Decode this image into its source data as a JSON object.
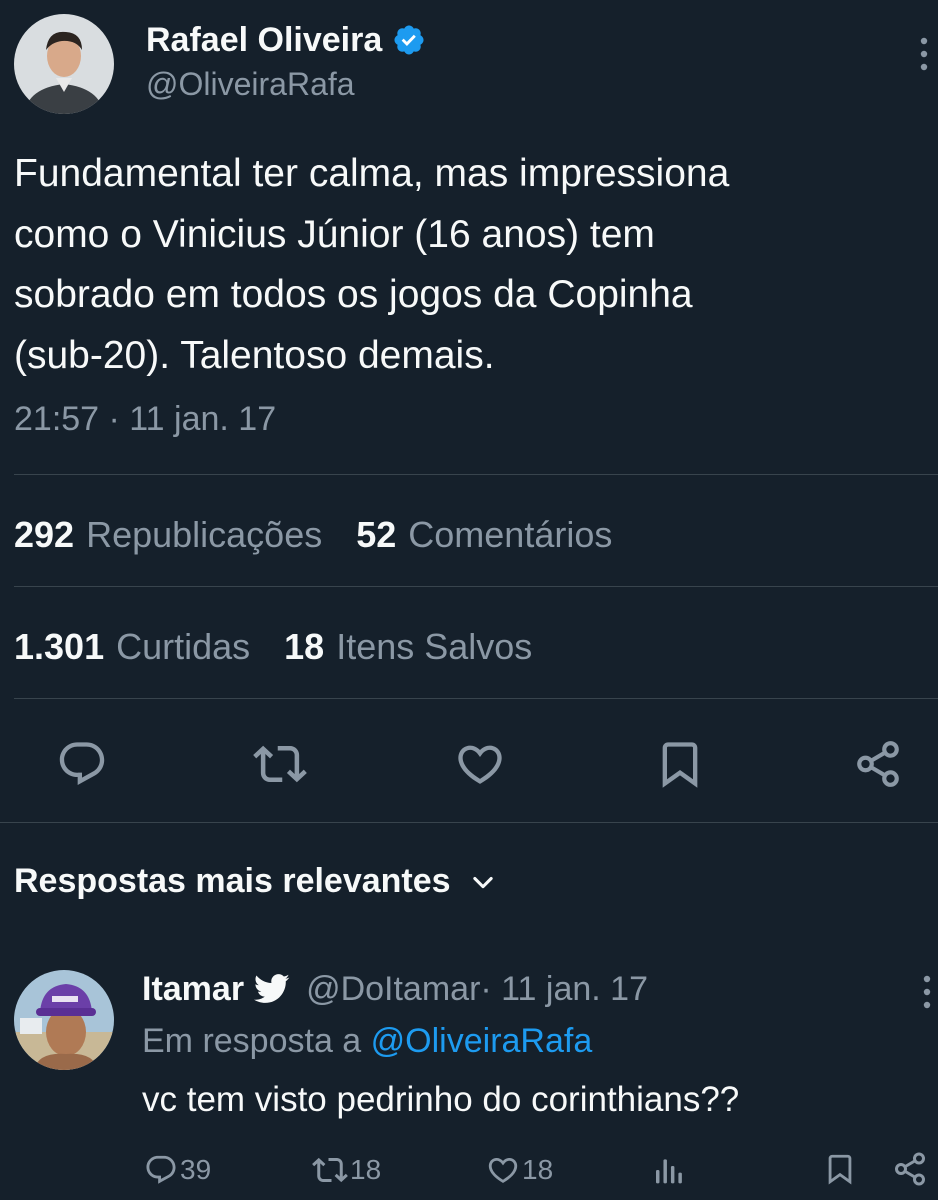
{
  "tweet": {
    "author_name": "Rafael Oliveira",
    "author_handle": "@OliveiraRafa",
    "verified_icon": "verified-badge-icon",
    "text_lines": [
      "Fundamental ter calma, mas impressiona",
      "como o Vinicius Júnior (16 anos) tem",
      "sobrado em todos os jogos da Copinha",
      "(sub-20). Talentoso demais."
    ],
    "timestamp": "21:57 · 11 jan. 17",
    "stats": {
      "reposts_count": "292",
      "reposts_label": "Republicações",
      "comments_count": "52",
      "comments_label": "Comentários",
      "likes_count": "1.301",
      "likes_label": "Curtidas",
      "bookmarks_count": "18",
      "bookmarks_label": "Itens Salvos"
    },
    "actions": [
      "reply-icon",
      "retweet-icon",
      "like-icon",
      "bookmark-icon",
      "share-icon"
    ]
  },
  "replies_section": {
    "title": "Respostas mais relevantes"
  },
  "reply": {
    "author_name": "Itamar",
    "author_handle": "@DoItamar",
    "date": " · 11 jan. 17",
    "in_reply_prefix": "Em resposta a ",
    "in_reply_handle": "@OliveiraRafa",
    "text": "vc tem visto pedrinho do corinthians??",
    "replies_count": "39",
    "retweets_count": "18",
    "likes_count": "18"
  },
  "colors": {
    "background": "#15202b",
    "text": "#f7f9f9",
    "muted": "#8b98a5",
    "accent": "#1d9bf0",
    "divider": "#38444d"
  }
}
